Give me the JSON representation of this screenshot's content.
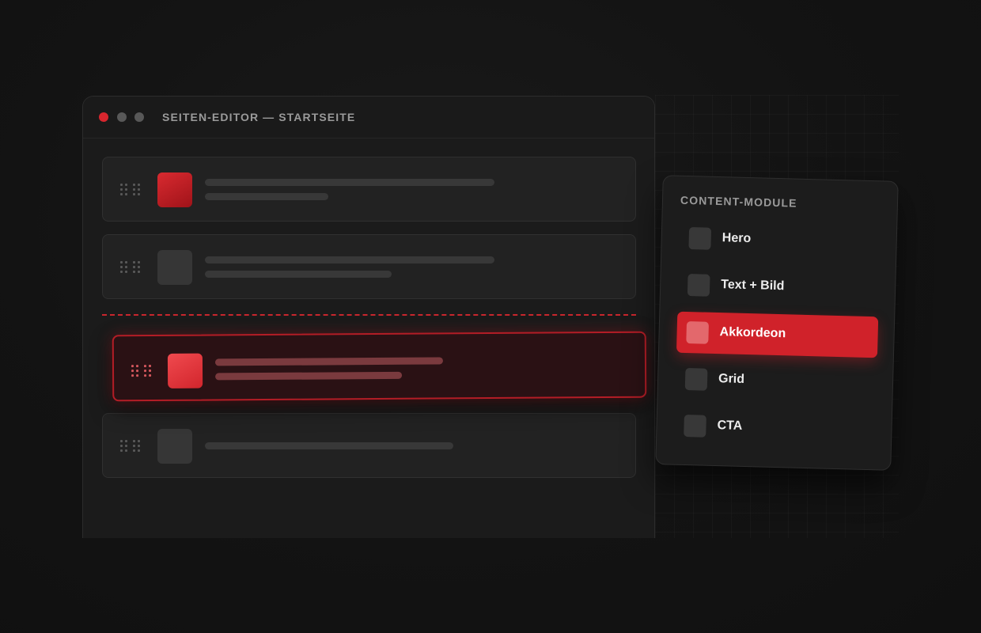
{
  "window": {
    "title": "SEITEN-EDITOR — STARTSEITE",
    "controls": [
      "close",
      "minimize",
      "maximize"
    ]
  },
  "editor": {
    "rows": [
      {
        "thumb": "red",
        "lines": 2
      },
      {
        "thumb": "grey",
        "lines": 2
      },
      {
        "thumb": "grey",
        "lines": 1
      }
    ],
    "dragging": {
      "thumb": "red",
      "lines": 2,
      "state": "dragging"
    },
    "drop_indicator": "dashed-red"
  },
  "panel": {
    "title": "CONTENT-MODULE",
    "modules": [
      {
        "label": "Hero",
        "active": false
      },
      {
        "label": "Text + Bild",
        "active": false
      },
      {
        "label": "Akkordeon",
        "active": true
      },
      {
        "label": "Grid",
        "active": false
      },
      {
        "label": "CTA",
        "active": false
      }
    ]
  },
  "colors": {
    "accent": "#d0222a",
    "background": "#121212",
    "window": "#1b1b1b"
  }
}
